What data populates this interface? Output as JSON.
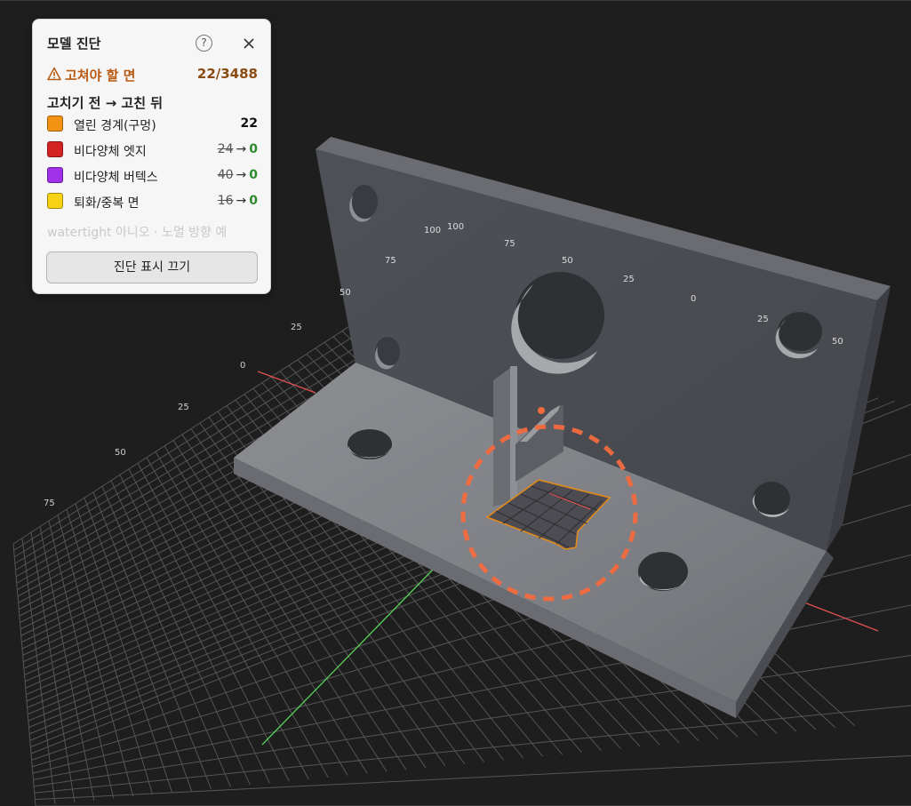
{
  "panel": {
    "title": "모델 진단",
    "help_glyph": "?",
    "warning_label": "고쳐야 할 면",
    "warning_count": "22/3488",
    "section_title": "고치기 전 → 고친 뒤",
    "items": [
      {
        "label": "열린 경계(구멍)",
        "color": "#f39313",
        "total": "22"
      },
      {
        "label": "비다양체 엣지",
        "color": "#d42222",
        "before": "24",
        "arrow": "→",
        "after": "0"
      },
      {
        "label": "비다양체 버텍스",
        "color": "#a030ea",
        "before": "40",
        "arrow": "→",
        "after": "0"
      },
      {
        "label": "퇴화/중복 면",
        "color": "#f5d214",
        "before": "16",
        "arrow": "→",
        "after": "0"
      }
    ],
    "info": "watertight 아니오 · 노멀 방향 예",
    "toggle_label": "진단 표시 끄기"
  },
  "viewport": {
    "plate_scale_labels": [
      "100",
      "100",
      "75",
      "75",
      "50",
      "50",
      "25",
      "0",
      "25",
      "50"
    ],
    "grid_axis_labels": [
      "25",
      "0",
      "25",
      "50",
      "75"
    ],
    "colors": {
      "background": "#1e1e1e",
      "grid": "#6a6a6a",
      "x_axis": "#e0524f",
      "y_axis": "#58d058",
      "highlight": "#f46a3e",
      "open_boundary": "#e18a1d",
      "model": "#5a5c62"
    }
  }
}
